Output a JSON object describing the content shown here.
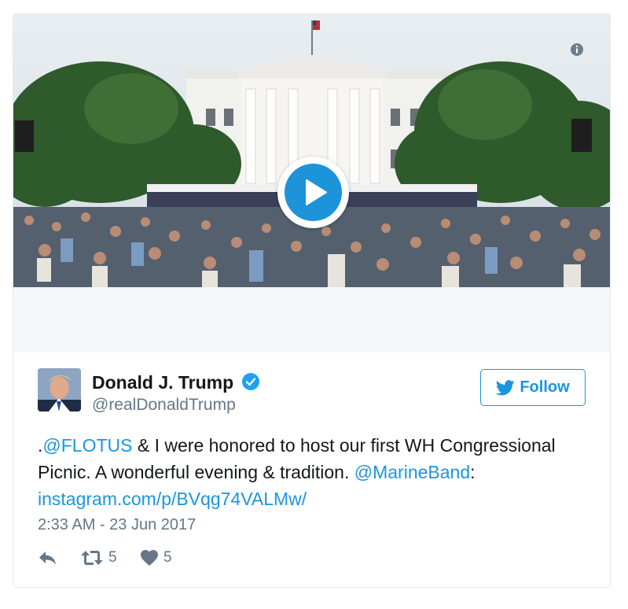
{
  "tweet": {
    "author_name": "Donald J. Trump",
    "handle": "@realDonaldTrump",
    "follow_label": "Follow",
    "text": {
      "prefix": ".",
      "mention_flotus": "@FLOTUS",
      "part1": " & I were honored to host our first WH Congressional Picnic. A wonderful evening & tradition. ",
      "mention_band": "@MarineBand",
      "part2": ": ",
      "link": "instagram.com/p/BVqg74VALMw/"
    },
    "timestamp": "2:33 AM - 23 Jun 2017",
    "retweet_count": "5",
    "like_count": "5"
  },
  "icons": {
    "info": "info-icon",
    "play": "play-icon",
    "verified": "verified-badge-icon",
    "twitter_bird": "twitter-bird-icon",
    "reply": "reply-icon",
    "retweet": "retweet-icon",
    "like": "heart-icon"
  },
  "colors": {
    "brand_blue": "#1b95e0",
    "play_blue": "#1d93d9",
    "muted_text": "#657786",
    "border": "#e1e8ed"
  }
}
